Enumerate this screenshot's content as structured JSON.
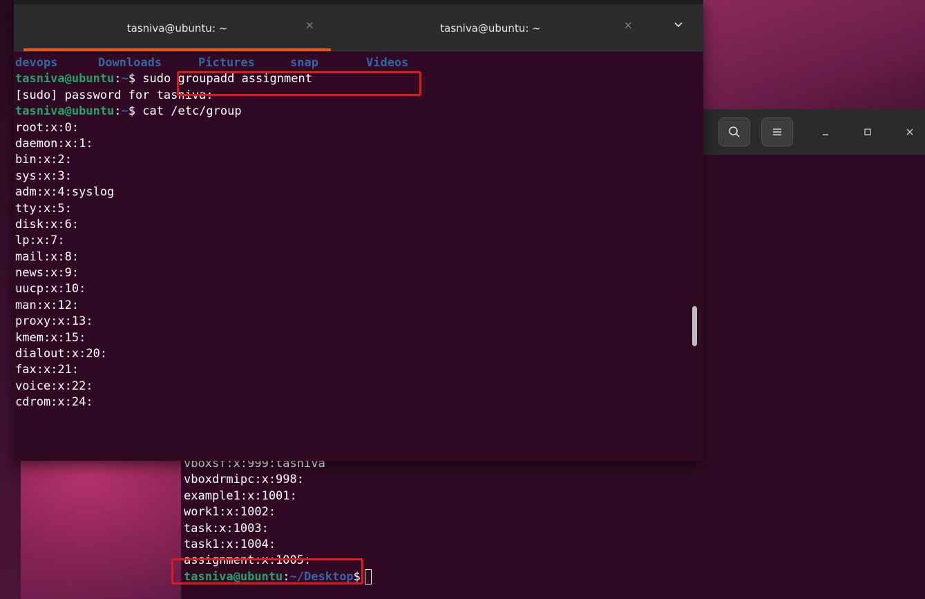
{
  "back_terminal": {
    "lines": [
      "vboxsf:x:999:tasniva",
      "vboxdrmipc:x:998:",
      "example1:x:1001:",
      "work1:x:1002:",
      "task:x:1003:",
      "task1:x:1004:",
      "assignment:x:1005:"
    ],
    "prompt_user": "tasniva@ubuntu",
    "prompt_sep": ":",
    "prompt_path": "~/Desktop",
    "prompt_symbol": "$"
  },
  "front_terminal": {
    "tabs": [
      {
        "label": "tasniva@ubuntu: ~",
        "active": true
      },
      {
        "label": "tasniva@ubuntu: ~",
        "active": false
      }
    ],
    "ls_output": [
      "devops",
      "Downloads",
      "Pictures",
      "snap",
      "Videos"
    ],
    "prompt_user": "tasniva@ubuntu",
    "prompt_sep": ":",
    "prompt_path": "~",
    "prompt_symbol": "$",
    "command1": "sudo groupadd assignment",
    "sudo_prompt": "[sudo] password for tasniva:",
    "command2": "cat /etc/group",
    "group_lines": [
      "root:x:0:",
      "daemon:x:1:",
      "bin:x:2:",
      "sys:x:3:",
      "adm:x:4:syslog",
      "tty:x:5:",
      "disk:x:6:",
      "lp:x:7:",
      "mail:x:8:",
      "news:x:9:",
      "uucp:x:10:",
      "man:x:12:",
      "proxy:x:13:",
      "kmem:x:15:",
      "dialout:x:20:",
      "fax:x:21:",
      "voice:x:22:",
      "cdrom:x:24:"
    ]
  },
  "icons": {
    "search": "search-icon",
    "menu": "hamburger-menu-icon",
    "minimize": "minimize-icon",
    "maximize": "maximize-icon",
    "close": "close-icon",
    "dropdown": "chevron-down-icon"
  },
  "colors": {
    "terminal_bg": "#300a24",
    "prompt_user": "#26a269",
    "prompt_path": "#3465a4",
    "highlight": "#e0191b",
    "tab_accent": "#e95420"
  }
}
